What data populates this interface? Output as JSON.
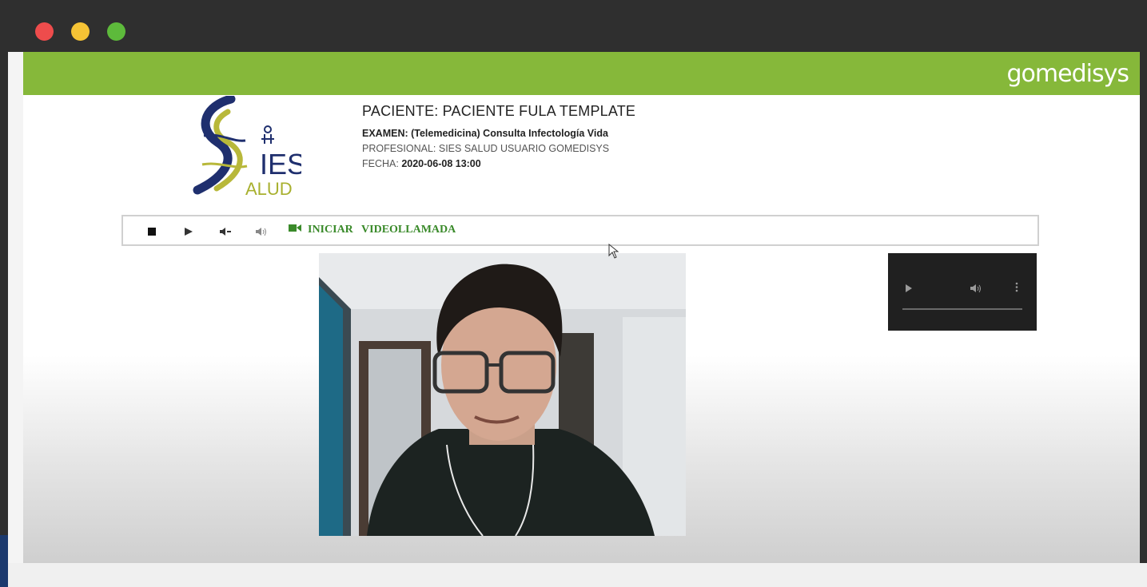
{
  "window": {
    "controls": [
      "close",
      "minimize",
      "maximize"
    ]
  },
  "header": {
    "brand": "gomedisys",
    "brand_color": "#86b83a"
  },
  "logo": {
    "text_main": "IES",
    "text_sub": "ALUD"
  },
  "patient": {
    "name": "PACIENTE: PACIENTE FULA TEMPLATE",
    "exam": "EXAMEN: (Telemedicina) Consulta Infectología Vida",
    "professional": "PROFESIONAL: SIES SALUD USUARIO GOMEDISYS",
    "date_label": "FECHA:",
    "date_value": "2020-06-08 13:00"
  },
  "controls": {
    "icons": [
      "stop-icon",
      "play-icon",
      "volume-down-icon",
      "volume-up-icon"
    ],
    "start_call_label": "INICIAR   VIDEOLLAMADA"
  },
  "mini_player": {
    "icons": [
      "play-icon",
      "volume-icon",
      "more-options-icon"
    ]
  }
}
